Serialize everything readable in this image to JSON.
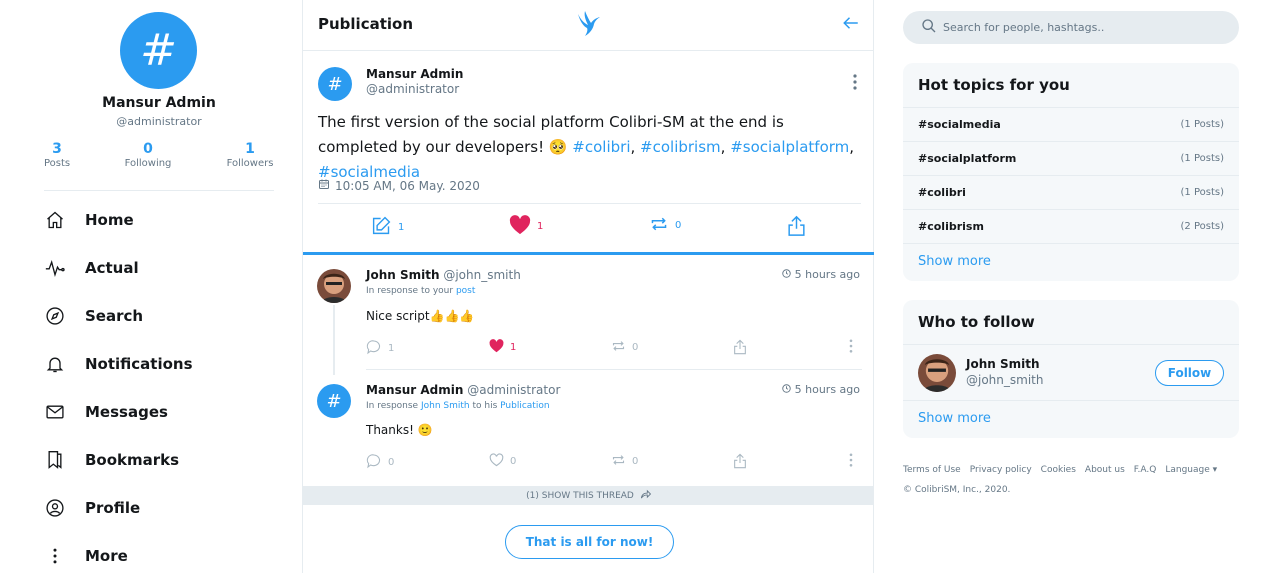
{
  "profile": {
    "avatar_glyph": "#",
    "name": "Mansur Admin",
    "handle": "@administrator",
    "stats": [
      {
        "num": "3",
        "label": "Posts"
      },
      {
        "num": "0",
        "label": "Following"
      },
      {
        "num": "1",
        "label": "Followers"
      }
    ]
  },
  "nav": [
    {
      "label": "Home",
      "icon": "home-icon"
    },
    {
      "label": "Actual",
      "icon": "pulse-icon"
    },
    {
      "label": "Search",
      "icon": "compass-icon"
    },
    {
      "label": "Notifications",
      "icon": "bell-icon"
    },
    {
      "label": "Messages",
      "icon": "mail-icon"
    },
    {
      "label": "Bookmarks",
      "icon": "bookmark-icon"
    },
    {
      "label": "Profile",
      "icon": "user-icon"
    },
    {
      "label": "More",
      "icon": "more-icon"
    }
  ],
  "center": {
    "title": "Publication",
    "logo": "bird-logo",
    "back": "arrow-left-icon"
  },
  "post": {
    "avatar_glyph": "#",
    "name": "Mansur Admin",
    "handle": "@administrator",
    "text_main": "The first version of the social platform Colibri-SM at the end is completed by our developers! 🥺 ",
    "tags": [
      "#colibri",
      "#colibrism",
      "#socialplatform",
      "#socialmedia"
    ],
    "tag_sep": ", ",
    "date": "10:05 AM, 06 May. 2020",
    "actions": {
      "reply": "1",
      "like": "1",
      "repost": "0"
    }
  },
  "replies": [
    {
      "name": "John Smith",
      "handle": "@john_smith",
      "resp_prefix": "In response to your ",
      "resp_link": "post",
      "time": "5 hours ago",
      "text": "Nice script👍👍👍",
      "actions": {
        "reply": "1",
        "like": "1",
        "repost": "0"
      }
    },
    {
      "avatar_glyph": "#",
      "name": "Mansur Admin",
      "handle": "@administrator",
      "resp_prefix": "In response ",
      "resp_link": "John Smith",
      "resp_mid": " to his ",
      "resp_link2": "Publication",
      "time": "5 hours ago",
      "text": "Thanks! 🙂",
      "actions": {
        "reply": "0",
        "like": "0",
        "repost": "0"
      }
    }
  ],
  "show_thread": "(1) SHOW THIS THREAD",
  "all_for_now": "That is all for now!",
  "search": {
    "placeholder": "Search for people, hashtags.."
  },
  "hot_topics": {
    "title": "Hot topics for you",
    "items": [
      {
        "tag": "#socialmedia",
        "count": "(1 Posts)"
      },
      {
        "tag": "#socialplatform",
        "count": "(1 Posts)"
      },
      {
        "tag": "#colibri",
        "count": "(1 Posts)"
      },
      {
        "tag": "#colibrism",
        "count": "(2 Posts)"
      }
    ],
    "show_more": "Show more"
  },
  "who_to_follow": {
    "title": "Who to follow",
    "user": {
      "name": "John Smith",
      "handle": "@john_smith",
      "button": "Follow"
    },
    "show_more": "Show more"
  },
  "footer": {
    "links": [
      "Terms of Use",
      "Privacy policy",
      "Cookies",
      "About us",
      "F.A.Q",
      "Language"
    ],
    "copyright": "© ColibriSM, Inc., 2020."
  },
  "colors": {
    "accent": "#2b9bf0",
    "like": "#e0245e",
    "muted": "#657786",
    "border": "#e6ecf0"
  }
}
